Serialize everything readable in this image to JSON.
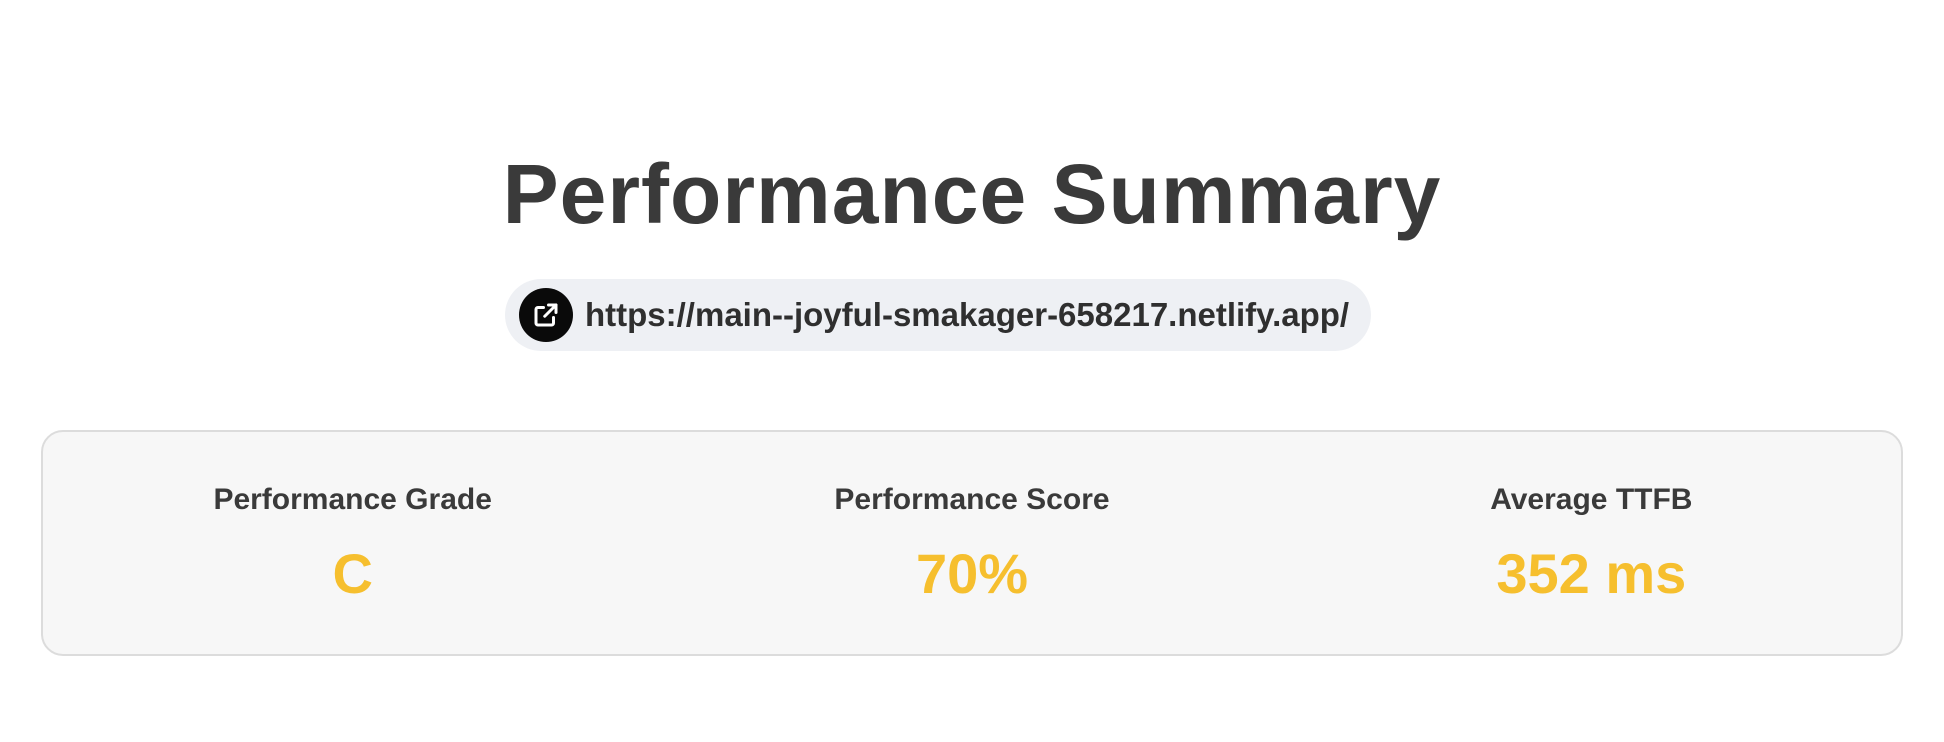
{
  "page": {
    "title": "Performance Summary"
  },
  "site": {
    "url": "https://main--joyful-smakager-658217.netlify.app/",
    "icon": "external-link-icon"
  },
  "metrics": [
    {
      "label": "Performance Grade",
      "value": "C"
    },
    {
      "label": "Performance Score",
      "value": "70%"
    },
    {
      "label": "Average TTFB",
      "value": "352 ms"
    }
  ],
  "colors": {
    "text": "#3a3a3a",
    "value_accent": "#f6bf2e",
    "pill_background": "#eef0f4",
    "card_background": "#f7f7f7",
    "card_border": "#dcdcdc",
    "icon_background": "#0a0a0a"
  }
}
